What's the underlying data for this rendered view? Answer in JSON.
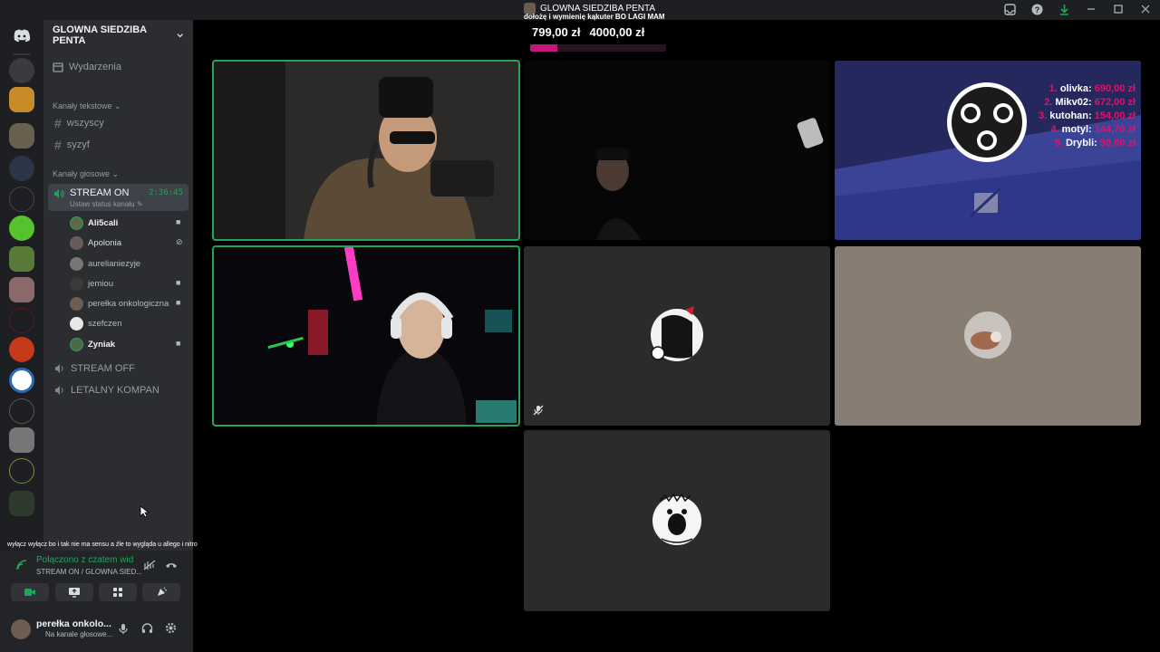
{
  "titlebar": {
    "title": "GLOWNA SIEDZIBA PENTA",
    "icons": [
      "inbox-icon",
      "help-icon",
      "download-icon",
      "minimize-icon",
      "maximize-icon",
      "close-icon"
    ]
  },
  "overlay": {
    "alert_message": "dołożę i wymienię kąkuter BO LAGI MAM",
    "goal_current": "799,00 zł",
    "goal_target": "4000,00 zł",
    "goal_progress": 0.2
  },
  "guild": {
    "name": "GLOWNA SIEDZIBA PENTA",
    "events_label": "Wydarzenia",
    "text_category": "Kanały tekstowe",
    "text_channels": [
      "wszyscy",
      "syzyf"
    ],
    "voice_category": "Kanały głosowe",
    "active_voice": {
      "name": "STREAM ON",
      "elapsed": "2:36:45",
      "status": "Ustaw status kanału"
    },
    "members": [
      {
        "name": "Ali5cali",
        "bold": true,
        "icon": "camera-icon"
      },
      {
        "name": "Apolonia",
        "bold": false,
        "icon": "muted-icon"
      },
      {
        "name": "aurelianiezyje",
        "bold": false,
        "icon": ""
      },
      {
        "name": "jemiou",
        "bold": false,
        "icon": "camera-icon"
      },
      {
        "name": "perełka onkologiczna",
        "bold": false,
        "icon": "camera-icon"
      },
      {
        "name": "szefczen",
        "bold": false,
        "icon": ""
      },
      {
        "name": "Zyniak",
        "bold": true,
        "icon": "camera-icon"
      }
    ],
    "other_voice": [
      "STREAM OFF",
      "LETALNY KOMPAN"
    ]
  },
  "chat_ticker": "wyłącz wyłącz bo i tak nie ma sensu a źle to wygląda u allego i nitro",
  "connection": {
    "status": "Połączono z czatem wid",
    "location": "STREAM ON / GLOWNA SIED..."
  },
  "user": {
    "name": "perełka onkolo...",
    "status": "Na kanale głosowe..."
  },
  "leaderboard": [
    {
      "rank": "1.",
      "name": "olivka:",
      "amount": "690,00 zł"
    },
    {
      "rank": "2.",
      "name": "Mikv02:",
      "amount": "672,00 zł"
    },
    {
      "rank": "3.",
      "name": "kutohan:",
      "amount": "154,00 zł"
    },
    {
      "rank": "4.",
      "name": "motyl:",
      "amount": "144,70 zł"
    },
    {
      "rank": "5.",
      "name": "Drybli:",
      "amount": "50,00 zł"
    }
  ],
  "colors": {
    "accent_green": "#23a559",
    "goal_pink": "#c4177a",
    "obs_blue": "#2a2f7e"
  }
}
